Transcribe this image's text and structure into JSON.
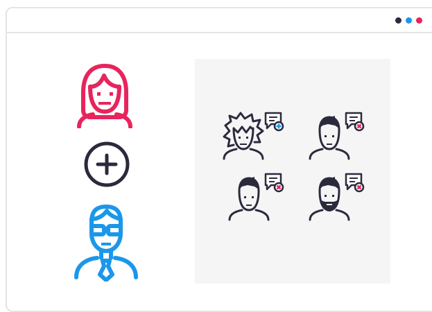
{
  "window": {
    "controls": [
      {
        "name": "window-control-dot-dark",
        "color": "#2b2a3d"
      },
      {
        "name": "window-control-dot-blue",
        "color": "#1b97ea"
      },
      {
        "name": "window-control-dot-pink",
        "color": "#e8245c"
      }
    ]
  },
  "colors": {
    "pink": "#e8245c",
    "blue": "#1b97ea",
    "dark": "#2b2a3d",
    "panel": "#f5f5f5",
    "border": "#e4e4e4"
  },
  "icons": {
    "woman_avatar": "woman-avatar-icon",
    "plus": "plus-circle-icon",
    "businessman_avatar": "businessman-avatar-icon",
    "chat_add": "chat-add-icon",
    "chat_remove": "chat-remove-icon"
  },
  "members": [
    {
      "avatar": "wild-hair-person-avatar-icon",
      "chat_status": "add",
      "chat_badge_color": "#1b97ea"
    },
    {
      "avatar": "man-avatar-icon",
      "chat_status": "remove",
      "chat_badge_color": "#e8245c"
    },
    {
      "avatar": "man-avatar-icon",
      "chat_status": "remove",
      "chat_badge_color": "#e8245c"
    },
    {
      "avatar": "bearded-man-avatar-icon",
      "chat_status": "remove",
      "chat_badge_color": "#e8245c"
    }
  ]
}
